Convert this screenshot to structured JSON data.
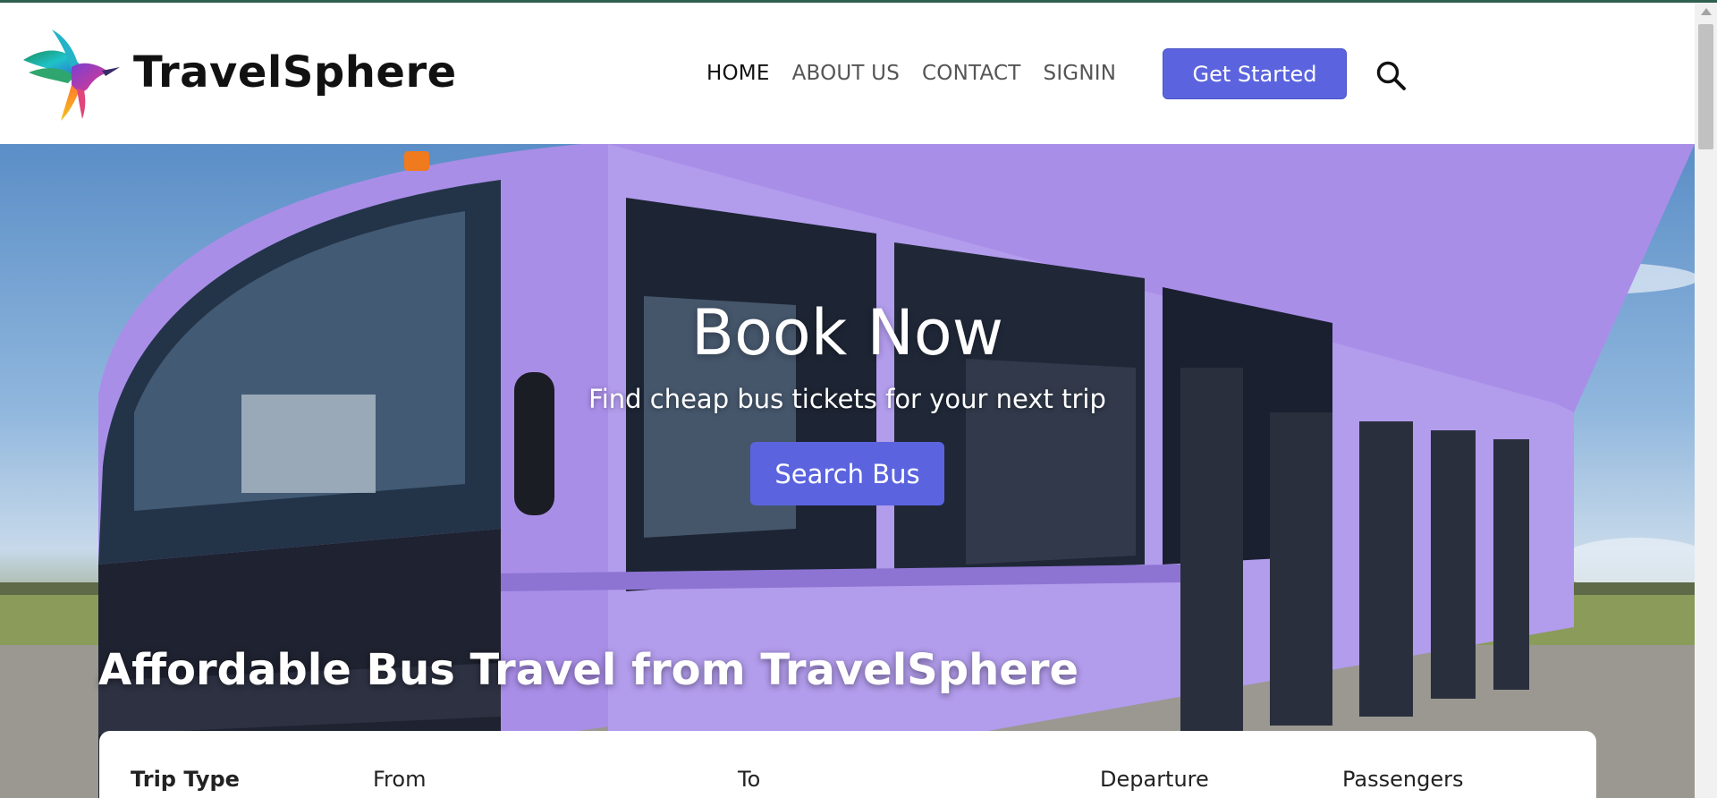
{
  "brand": {
    "name": "TravelSphere",
    "logo_icon": "hummingbird-logo-icon"
  },
  "nav": {
    "items": [
      {
        "label": "HOME",
        "active": true
      },
      {
        "label": "ABOUT US",
        "active": false
      },
      {
        "label": "CONTACT",
        "active": false
      },
      {
        "label": "SIGNIN",
        "active": false
      }
    ],
    "cta_label": "Get Started",
    "search_icon": "search-icon"
  },
  "hero": {
    "title": "Book Now",
    "subtitle": "Find cheap bus tickets for your next trip",
    "button_label": "Search Bus",
    "headline": "Affordable Bus Travel from TravelSphere",
    "image": "purple-bus-photo"
  },
  "booking": {
    "trip_type_label": "Trip Type",
    "from_label": "From",
    "to_label": "To",
    "departure_label": "Departure",
    "passengers_label": "Passengers"
  },
  "colors": {
    "accent": "#5b64de",
    "bus_body": "#a98ee8",
    "text_dark": "#111111",
    "nav_text": "#555555"
  }
}
